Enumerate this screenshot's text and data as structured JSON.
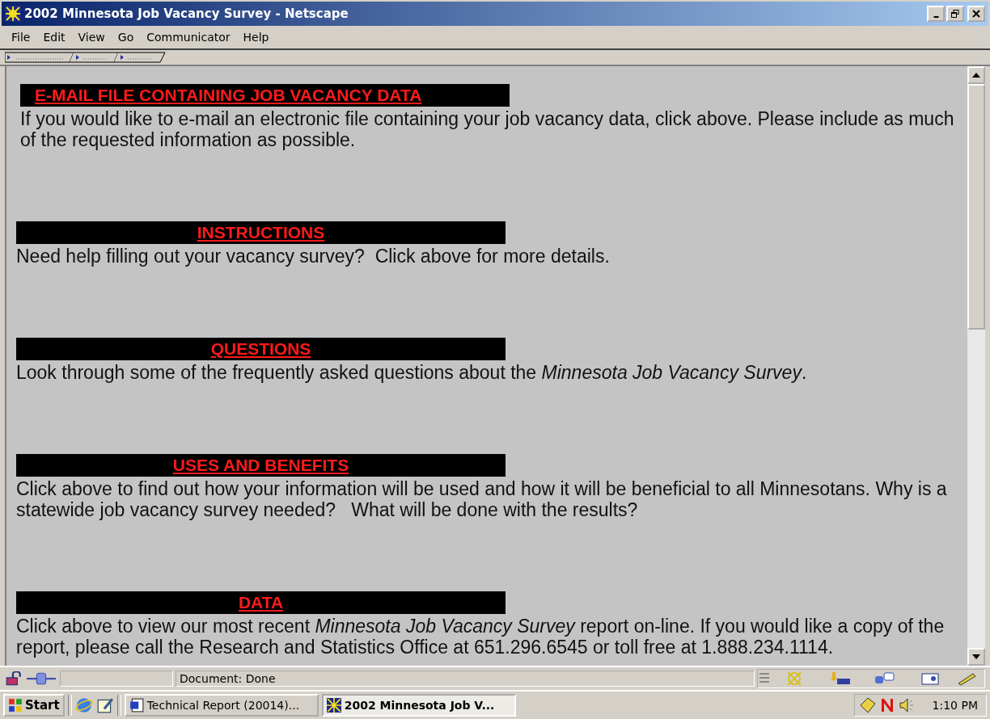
{
  "window": {
    "title": "2002 Minnesota Job Vacancy Survey - Netscape"
  },
  "menu": [
    "File",
    "Edit",
    "View",
    "Go",
    "Communicator",
    "Help"
  ],
  "sections": [
    {
      "heading": "E-MAIL FILE CONTAINING JOB VACANCY DATA",
      "text": "If you would like to e-mail an electronic file containing your job vacancy data, click above. Please include as much of the requested information as possible."
    },
    {
      "heading": "INSTRUCTIONS",
      "text": "Need help filling out your vacancy survey?  Click above for more details."
    },
    {
      "heading": "QUESTIONS",
      "text": "Look through some of the frequently asked questions about the *Minnesota Job Vacancy Survey*."
    },
    {
      "heading": "USES AND BENEFITS",
      "text": "Click above to find out how your information will be used and how it will be beneficial to all Minnesotans. Why is a statewide job vacancy survey needed?   What will be done with the results?"
    },
    {
      "heading": "DATA",
      "text": "Click above to view our most recent *Minnesota Job Vacancy Survey* report on-line. If you would like a copy of the report, please call the Research and Statistics Office at 651.296.6545 or toll free at 1.888.234.1114."
    }
  ],
  "status_bar": {
    "text": "Document: Done"
  },
  "taskbar": {
    "start": "Start",
    "tasks": [
      {
        "label": "Technical Report (20014)...",
        "kind": "word",
        "selected": false
      },
      {
        "label": "2002 Minnesota Job V...",
        "kind": "netscape",
        "selected": true
      }
    ],
    "time": "1:10 PM"
  }
}
